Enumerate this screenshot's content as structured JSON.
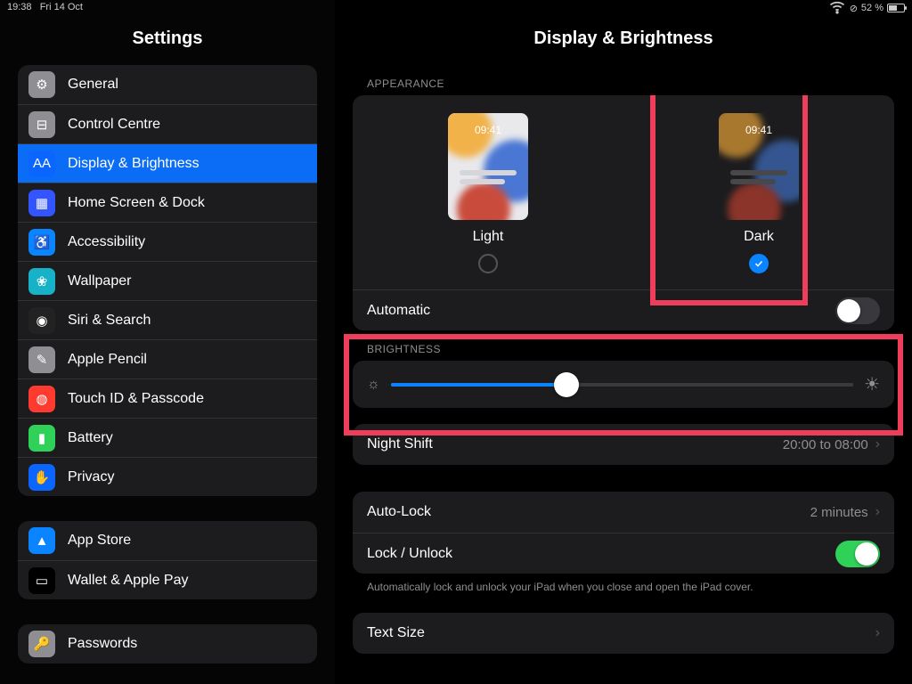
{
  "status": {
    "time": "19:38",
    "date": "Fri 14 Oct",
    "battery_pct": "52 %"
  },
  "sidebar": {
    "title": "Settings",
    "g1": [
      {
        "label": "General",
        "icon_bg": "#8e8e93",
        "glyph": "⚙"
      },
      {
        "label": "Control Centre",
        "icon_bg": "#8e8e93",
        "glyph": "⊟"
      },
      {
        "label": "Display & Brightness",
        "icon_bg": "#0a66ff",
        "glyph": "AA"
      },
      {
        "label": "Home Screen & Dock",
        "icon_bg": "#3355ff",
        "glyph": "▦"
      },
      {
        "label": "Accessibility",
        "icon_bg": "#0a84ff",
        "glyph": "♿"
      },
      {
        "label": "Wallpaper",
        "icon_bg": "#17b1c8",
        "glyph": "❀"
      },
      {
        "label": "Siri & Search",
        "icon_bg": "#222",
        "glyph": "◉"
      },
      {
        "label": "Apple Pencil",
        "icon_bg": "#8e8e93",
        "glyph": "✎"
      },
      {
        "label": "Touch ID & Passcode",
        "icon_bg": "#ff3b30",
        "glyph": "◍"
      },
      {
        "label": "Battery",
        "icon_bg": "#30d158",
        "glyph": "▮"
      },
      {
        "label": "Privacy",
        "icon_bg": "#0a66ff",
        "glyph": "✋"
      }
    ],
    "g2": [
      {
        "label": "App Store",
        "icon_bg": "#0a84ff",
        "glyph": "▲"
      },
      {
        "label": "Wallet & Apple Pay",
        "icon_bg": "#000",
        "glyph": "▭"
      }
    ],
    "g3": [
      {
        "label": "Passwords",
        "icon_bg": "#8e8e93",
        "glyph": "🔑"
      }
    ],
    "selected_index": 2
  },
  "detail": {
    "title": "Display & Brightness",
    "sections": {
      "appearance": {
        "header": "APPEARANCE",
        "options": [
          {
            "label": "Light",
            "preview_time": "09:41",
            "checked": false
          },
          {
            "label": "Dark",
            "preview_time": "09:41",
            "checked": true
          }
        ],
        "automatic": {
          "label": "Automatic",
          "on": false
        }
      },
      "brightness": {
        "header": "BRIGHTNESS",
        "value_pct": 38,
        "nightshift": {
          "label": "Night Shift",
          "value": "20:00 to 08:00"
        }
      },
      "lock": {
        "autolock": {
          "label": "Auto-Lock",
          "value": "2 minutes"
        },
        "lockunlock": {
          "label": "Lock / Unlock",
          "on": true
        },
        "note": "Automatically lock and unlock your iPad when you close and open the iPad cover."
      },
      "text": {
        "textsize": {
          "label": "Text Size"
        }
      }
    }
  }
}
